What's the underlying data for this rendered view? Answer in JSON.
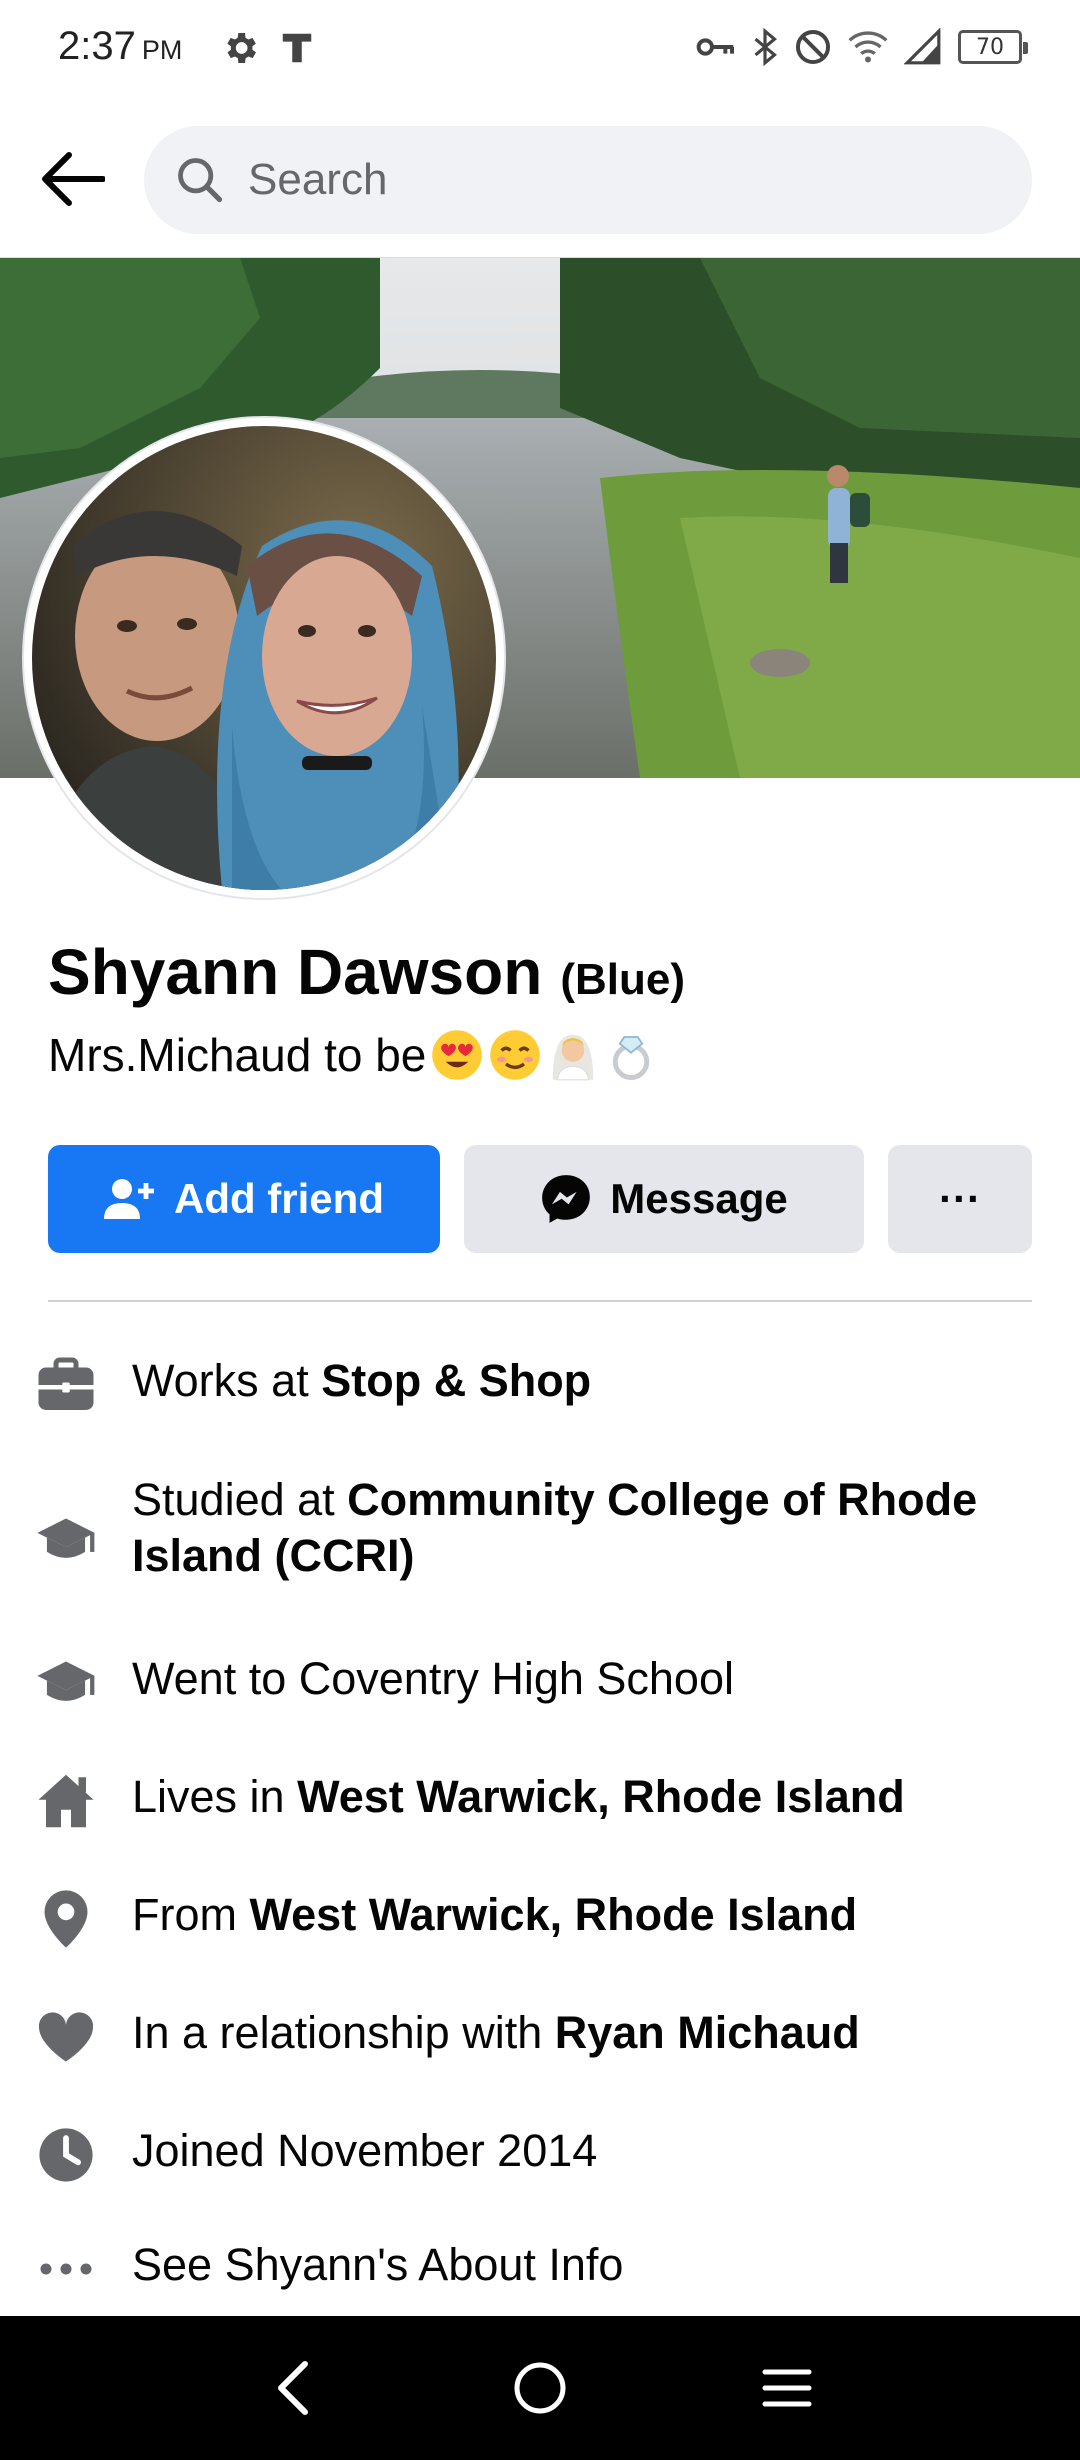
{
  "status_bar": {
    "time": "2:37",
    "ampm": "PM",
    "battery": "70"
  },
  "search": {
    "placeholder": "Search"
  },
  "profile": {
    "name": "Shyann Dawson",
    "alt_name": "(Blue)",
    "bio": "Mrs.Michaud to be",
    "bio_emojis": [
      "heart-eyes-emoji",
      "smiling-face-emoji",
      "bride-emoji",
      "ring-emoji"
    ]
  },
  "actions": {
    "add_friend": "Add friend",
    "message": "Message",
    "more": "···"
  },
  "info": {
    "work_prefix": "Works at ",
    "work_place": "Stop & Shop",
    "studied_prefix": "Studied at ",
    "studied_place": "Community College of Rhode Island (CCRI)",
    "went_to": "Went to Coventry High School",
    "lives_prefix": "Lives in ",
    "lives_place": "West Warwick, Rhode Island",
    "from_prefix": "From ",
    "from_place": "West Warwick, Rhode Island",
    "relationship_prefix": "In a relationship with ",
    "relationship_person": "Ryan Michaud",
    "joined": "Joined November 2014",
    "see_about": "See Shyann's About Info"
  },
  "colors": {
    "brand_blue": "#1877f2",
    "button_gray": "#e4e6eb",
    "icon_gray": "#65676b"
  }
}
